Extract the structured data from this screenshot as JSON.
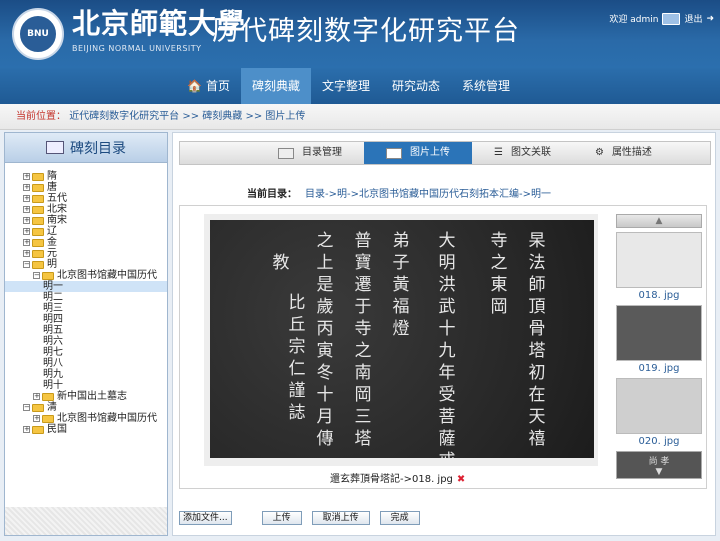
{
  "header": {
    "uni_name": "北京師範大學",
    "uni_en": "BEIJING NORMAL UNIVERSITY",
    "seal_text": "BNU",
    "system_title": "历代碑刻数字化研究平台",
    "welcome": "欢迎 admin",
    "logout": "退出"
  },
  "nav": {
    "items": [
      {
        "label": "首页"
      },
      {
        "label": "碑刻典藏"
      },
      {
        "label": "文字整理"
      },
      {
        "label": "研究动态"
      },
      {
        "label": "系统管理"
      }
    ]
  },
  "breadcrumb": {
    "label": "当前位置：",
    "path": "近代碑刻数字化研究平台 >> 碑刻典藏 >> 图片上传"
  },
  "sidebar": {
    "title": "碑刻目录",
    "tree": [
      "隋",
      "唐",
      "五代",
      "北宋",
      "南宋",
      "辽",
      "金",
      "元",
      "明",
      "北京图书馆藏中国历代"
    ],
    "leaves": [
      "明一",
      "明二",
      "明三",
      "明四",
      "明五",
      "明六",
      "明七",
      "明八",
      "明九",
      "明十"
    ],
    "tree_after": [
      "新中国出土墓志",
      "清",
      "北京图书馆藏中国历代",
      "民国"
    ]
  },
  "tabs": [
    {
      "label": "目录管理"
    },
    {
      "label": "图片上传"
    },
    {
      "label": "图文关联"
    },
    {
      "label": "属性描述"
    }
  ],
  "current_dir": {
    "label": "当前目录：",
    "path": "目录->明->北京图书馆藏中国历代石刻拓本汇编->明一"
  },
  "viewer": {
    "caption": "還玄葬頂骨塔記->018. jpg",
    "delete_icon": "✖"
  },
  "thumbs": [
    {
      "name": "018. jpg"
    },
    {
      "name": "019. jpg"
    },
    {
      "name": "020. jpg"
    }
  ],
  "thumb_partial": "尚 孝",
  "rubbing": {
    "columns": [
      "杲法師頂骨塔初在天禧",
      "寺之東岡",
      "大明洪武十九年受菩薩戒",
      "弟子黃福燈",
      "普寶遷于寺之南岡三塔",
      "之上是歲丙寅冬十月傳",
      "教",
      "比丘宗仁謹誌"
    ]
  },
  "buttons": {
    "add_file": "添加文件...",
    "upload": "上传",
    "cancel": "取消上传",
    "done": "完成"
  }
}
